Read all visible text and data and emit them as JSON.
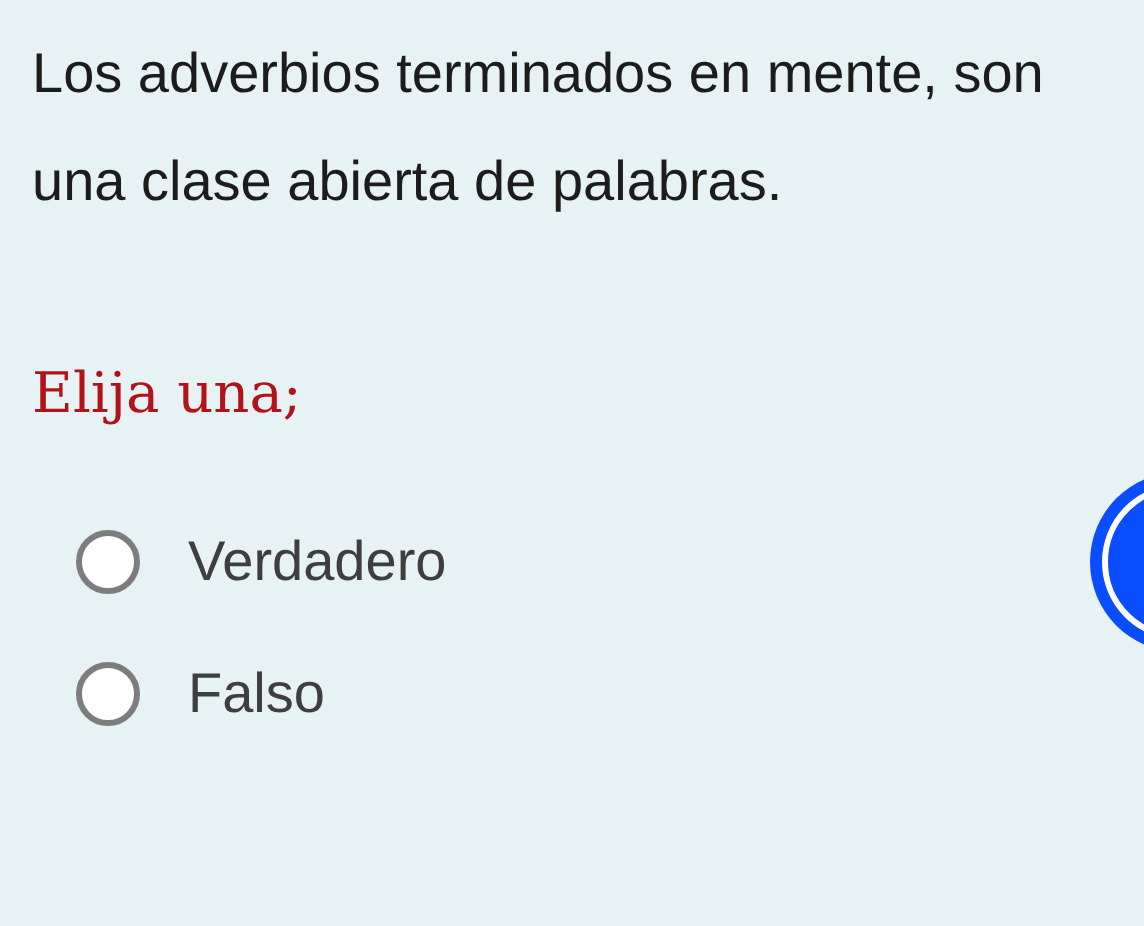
{
  "question": "Los adverbios terminados en mente, son una clase abierta de palabras.",
  "instruction": "Elija una;",
  "options": [
    {
      "label": "Verdadero",
      "selected": false
    },
    {
      "label": "Falso",
      "selected": false
    }
  ]
}
